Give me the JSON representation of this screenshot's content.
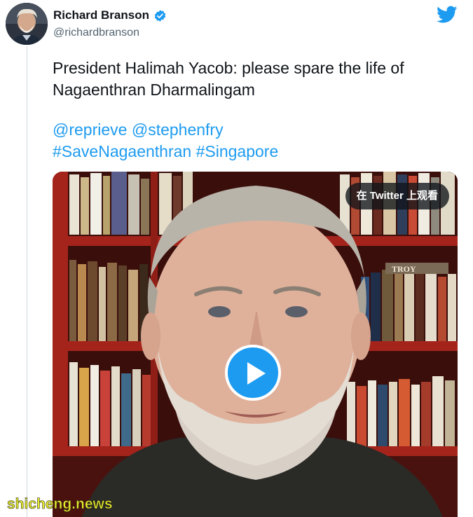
{
  "tweet": {
    "display_name": "Richard Branson",
    "handle": "@richardbranson",
    "text_line1": "President Halimah Yacob: please spare the life of",
    "text_line2": "Nagaenthran Dharmalingam",
    "mention1": "@reprieve",
    "mention2": "@stephenfry",
    "hashtag1": "#SaveNagaenthran",
    "hashtag2": "#Singapore"
  },
  "media": {
    "watch_label": "在 Twitter 上观看",
    "book_spine_text": "TROY"
  },
  "watermark": "shicheng.news",
  "icons": {
    "verified": "verified-badge-icon",
    "twitter": "twitter-bird-icon",
    "play": "play-icon"
  },
  "colors": {
    "link": "#1d9bf0",
    "text": "#0f1419",
    "handle": "#536471",
    "shelf_red": "#a4241b"
  }
}
